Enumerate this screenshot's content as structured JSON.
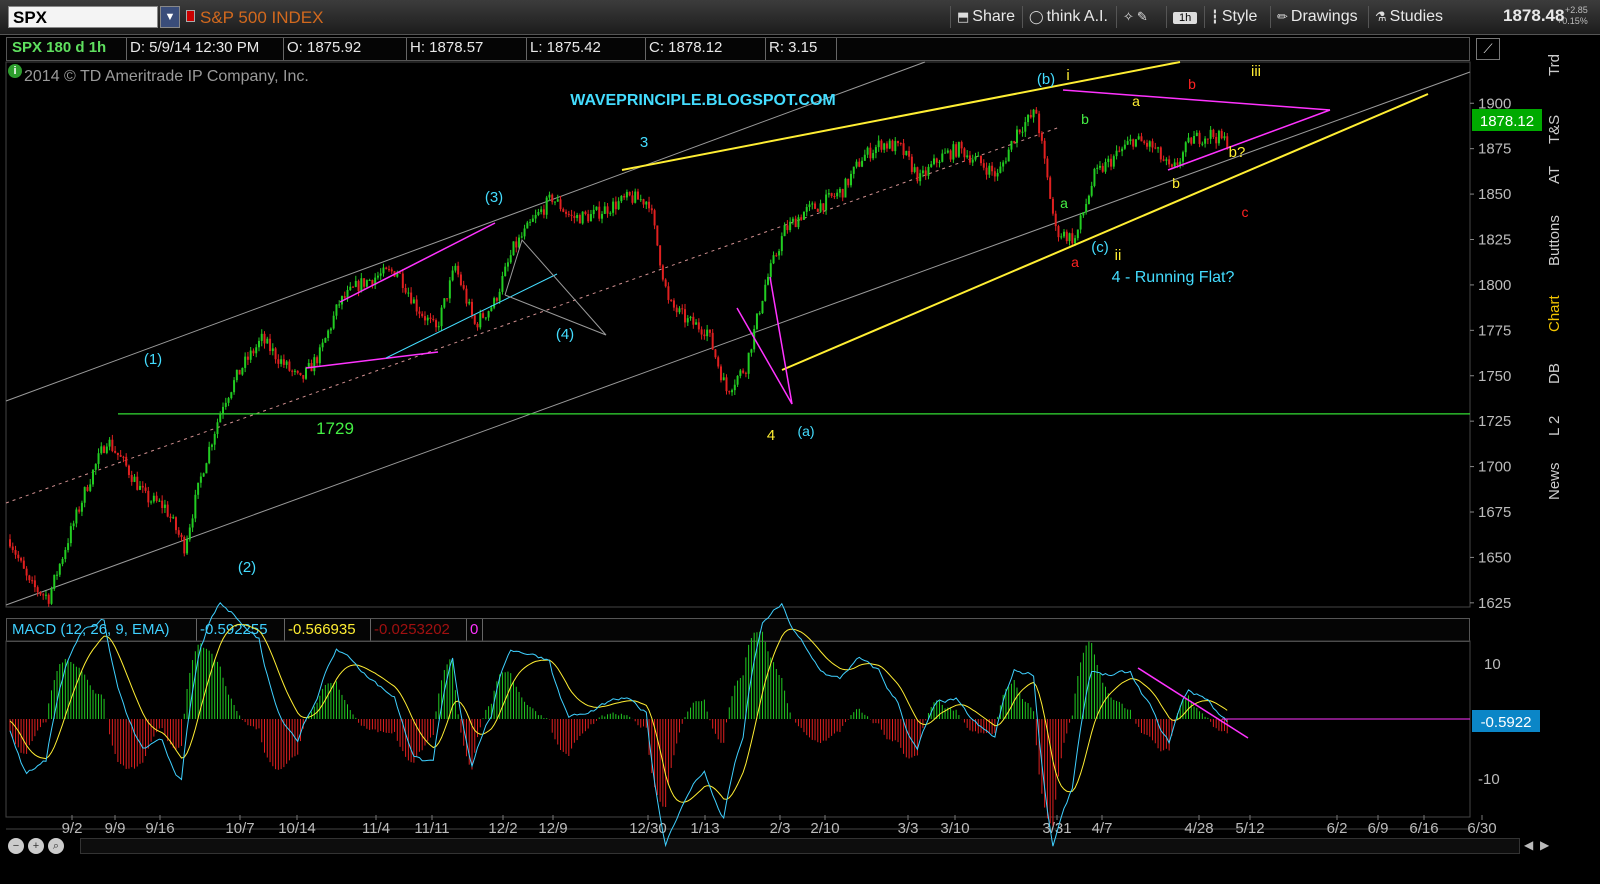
{
  "toolbar": {
    "symbol": "SPX",
    "symbol_name": "S&P 500 INDEX",
    "share": "Share",
    "think": "think A.I.",
    "interval": "1h",
    "style": "Style",
    "drawings": "Drawings",
    "studies": "Studies",
    "last_price": "1878.48",
    "change_abs": "+2.85",
    "change_pct": "+0.15%"
  },
  "quote": {
    "symbol_label": "SPX 180 d 1h",
    "date": "D: 5/9/14 12:30 PM",
    "open": "O: 1875.92",
    "high": "H: 1878.57",
    "low": "L: 1875.42",
    "close": "C: 1878.12",
    "range": "R: 3.15"
  },
  "copyright": "2014 © TD Ameritrade IP Company, Inc.",
  "side_tabs": [
    "Trd",
    "T&S",
    "AT",
    "Buttons",
    "Chart",
    "DB",
    "L 2",
    "News"
  ],
  "macd": {
    "label": "MACD (12, 26, 9, EMA)",
    "value": "-0.592255",
    "avg": "-0.566935",
    "diff": "-0.0253202",
    "zero": "0",
    "value_badge": "-0.5922"
  },
  "colors": {
    "up": "#22cc22",
    "down": "#e02020",
    "macd": "#3fd0ff",
    "avg": "#ffee33",
    "annotation_cyan": "#44ddff",
    "annotation_yellow": "#ffee33",
    "annotation_magenta": "#ff33ff",
    "annotation_green": "#44ee44",
    "annotation_red": "#ff2222"
  },
  "chart_data": {
    "type": "line",
    "title": "SPX 180 d 1h",
    "x_tick_labels": [
      "9/2",
      "9/9",
      "9/16",
      "10/7",
      "10/14",
      "11/4",
      "11/11",
      "12/2",
      "12/9",
      "12/30",
      "1/13",
      "2/3",
      "2/10",
      "3/3",
      "3/10",
      "3/31",
      "4/7",
      "4/28",
      "5/12",
      "6/2",
      "6/9",
      "6/16",
      "6/30"
    ],
    "y_tick_labels": [
      "1625",
      "1650",
      "1675",
      "1700",
      "1725",
      "1750",
      "1775",
      "1800",
      "1825",
      "1850",
      "1875",
      "1900"
    ],
    "ylim": [
      1615,
      1915
    ],
    "price_badge": "1878.12",
    "series": [
      {
        "x": [
          "8/30",
          "9/3",
          "9/6",
          "9/10",
          "9/13",
          "9/18",
          "9/24",
          "9/30",
          "10/4",
          "10/8",
          "10/11",
          "10/17",
          "10/22",
          "10/28",
          "11/1",
          "11/6",
          "11/8",
          "11/13",
          "11/18",
          "11/22",
          "11/27",
          "12/2",
          "12/6",
          "12/9",
          "12/13",
          "12/18",
          "12/23",
          "12/27",
          "12/31",
          "1/3",
          "1/8",
          "1/13",
          "1/15",
          "1/20",
          "1/24",
          "1/28",
          "1/31",
          "2/4",
          "2/6",
          "2/10",
          "2/14",
          "2/19",
          "2/24",
          "2/28",
          "3/3",
          "3/6",
          "3/10",
          "3/14",
          "3/18",
          "3/21",
          "3/25",
          "3/28",
          "4/2",
          "4/4",
          "4/9",
          "4/11",
          "4/15",
          "4/18",
          "4/22",
          "4/25",
          "4/29",
          "5/2",
          "5/5",
          "5/9"
        ],
        "values": [
          1660,
          1635,
          1628,
          1660,
          1690,
          1715,
          1700,
          1683,
          1678,
          1656,
          1700,
          1735,
          1755,
          1770,
          1758,
          1747,
          1762,
          1790,
          1800,
          1805,
          1808,
          1788,
          1775,
          1810,
          1778,
          1790,
          1820,
          1835,
          1848,
          1837,
          1838,
          1843,
          1848,
          1846,
          1790,
          1780,
          1775,
          1742,
          1755,
          1800,
          1830,
          1840,
          1845,
          1852,
          1870,
          1878,
          1875,
          1858,
          1870,
          1875,
          1868,
          1860,
          1885,
          1895,
          1830,
          1825,
          1860,
          1870,
          1880,
          1876,
          1862,
          1880,
          1883,
          1878
        ]
      }
    ],
    "levels": [
      {
        "value": 1729,
        "label": "1729"
      }
    ],
    "annotations": [
      "WAVEPRINCIPLE.BLOGSPOT.COM",
      "(1)",
      "(2)",
      "(3)",
      "(4)",
      "3",
      "4",
      "(a)",
      "(b)",
      "(c)",
      "i",
      "ii",
      "iii",
      "a",
      "b",
      "c",
      "b?",
      "4 - Running Flat?"
    ],
    "macd_yticks": [
      "10",
      "-10"
    ]
  }
}
